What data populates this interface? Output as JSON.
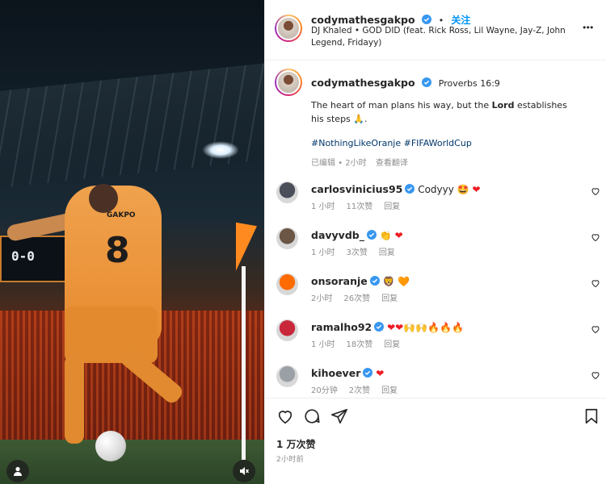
{
  "post": {
    "author": "codymathesgakpo",
    "follow_label": "关注",
    "separator": "•",
    "audio": "DJ Khaled • GOD DID (feat. Rick Ross, Lil Wayne, Jay-Z, John Legend, Fridayy)",
    "more_label": "•••"
  },
  "caption": {
    "author": "codymathesgakpo",
    "verse_ref": "Proverbs 16:9",
    "text_before": "The heart of man plans his way, but the ",
    "text_bold": "Lord",
    "text_after": " establishes his steps 🙏.",
    "hashtags": "#NothingLikeOranje #FIFAWorldCup",
    "edited": "已编辑",
    "dot": "•",
    "time": "2小时",
    "translate": "查看翻译"
  },
  "comments": [
    {
      "user": "carlosvinicius95",
      "text": "Codyyy 🤩",
      "hearts": "❤",
      "time": "1 小时",
      "likes": "11次赞",
      "reply": "回复",
      "avatar_color": "#4a4f5a"
    },
    {
      "user": "davyvdb_",
      "text": "👏",
      "hearts": "❤",
      "time": "1 小时",
      "likes": "3次赞",
      "reply": "回复",
      "avatar_color": "#6b5646"
    },
    {
      "user": "onsoranje",
      "text": "🦁",
      "hearts": "🧡",
      "time": "2小时",
      "likes": "26次赞",
      "reply": "回复",
      "avatar_color": "#ff6b00"
    },
    {
      "user": "ramalho92",
      "text": "",
      "hearts": "❤❤🙌🙌🔥🔥🔥",
      "time": "1 小时",
      "likes": "18次赞",
      "reply": "回复",
      "avatar_color": "#c9283a"
    },
    {
      "user": "kihoever",
      "text": "",
      "hearts": "❤",
      "time": "20分钟",
      "likes": "2次赞",
      "reply": "回复",
      "avatar_color": "#9aa0a6"
    }
  ],
  "footer": {
    "likes": "1 万次赞",
    "ago": "2小时前"
  },
  "media": {
    "jersey_number": "8",
    "jersey_name": "GAKPO",
    "scoreboard": "0-0"
  },
  "colors": {
    "accent": "#0095f6",
    "verified": "#3897f0",
    "heart": "#ed1c24"
  }
}
